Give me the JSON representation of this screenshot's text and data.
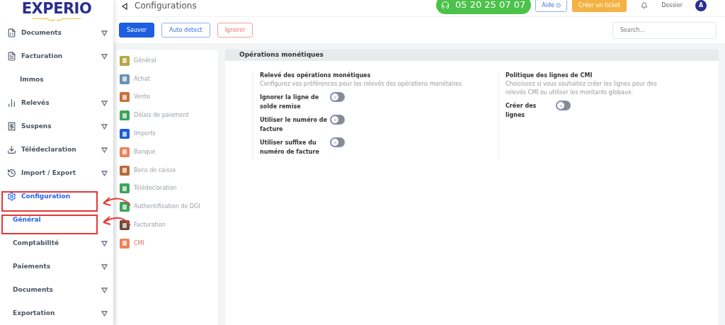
{
  "logo": {
    "text": "EXPERIO"
  },
  "sidebar": {
    "items": [
      {
        "label": "Documents",
        "kind": "group",
        "expandable": true,
        "selected": false
      },
      {
        "label": "Facturation",
        "kind": "group",
        "expandable": true,
        "selected": false
      },
      {
        "label": "Immos",
        "kind": "sub",
        "expandable": false,
        "selected": false
      },
      {
        "label": "Relevés",
        "kind": "group",
        "expandable": true,
        "selected": false
      },
      {
        "label": "Suspens",
        "kind": "group",
        "expandable": true,
        "selected": false
      },
      {
        "label": "Télédeclaration",
        "kind": "group",
        "expandable": true,
        "selected": false
      },
      {
        "label": "Import / Export",
        "kind": "group",
        "expandable": true,
        "selected": false
      },
      {
        "label": "Configuration",
        "kind": "group",
        "expandable": false,
        "selected": true
      },
      {
        "label": "Général",
        "kind": "sub",
        "expandable": false,
        "selected": true
      },
      {
        "label": "Comptabilité",
        "kind": "sub",
        "expandable": true,
        "selected": false
      },
      {
        "label": "Paiements",
        "kind": "sub",
        "expandable": true,
        "selected": false
      },
      {
        "label": "Documents",
        "kind": "sub",
        "expandable": true,
        "selected": false
      },
      {
        "label": "Exportation",
        "kind": "sub",
        "expandable": true,
        "selected": false
      }
    ]
  },
  "header": {
    "title": "Configurations",
    "phone": "05 20 25 07 07",
    "help": "Aide",
    "ticket": "Créer un ticket",
    "folder": "Dossier",
    "avatar": "A"
  },
  "toolbar": {
    "buttons": [
      {
        "label": "Sauver",
        "kind": "primary"
      },
      {
        "label": "Auto detect",
        "kind": "outline"
      },
      {
        "label": "Ignorer",
        "kind": "danger"
      }
    ],
    "search": {
      "placeholder": "Search..."
    }
  },
  "config_menu": [
    {
      "label": "Général",
      "color": "#b5a642",
      "selected": false
    },
    {
      "label": "Achat",
      "color": "#6d8fb3",
      "selected": false
    },
    {
      "label": "Vente",
      "color": "#c8703a",
      "selected": false
    },
    {
      "label": "Délais de paiement",
      "color": "#3aa35c",
      "selected": false
    },
    {
      "label": "Imports",
      "color": "#1e5bd6",
      "selected": false
    },
    {
      "label": "Banque",
      "color": "#e8845a",
      "selected": false
    },
    {
      "label": "Bons de caisse",
      "color": "#b86a3c",
      "selected": false
    },
    {
      "label": "Télédeclaration",
      "color": "#3aa35c",
      "selected": false
    },
    {
      "label": "Authentification de DGI",
      "color": "#3aa35c",
      "selected": false
    },
    {
      "label": "Facturation",
      "color": "#6b4a3a",
      "selected": false
    },
    {
      "label": "CMI",
      "color": "#e8845a",
      "selected": true
    }
  ],
  "panel": {
    "title": "Opérations monétiques",
    "sections": [
      {
        "title": "Relevé des opérations monétiques",
        "description": "Configurez vos préférences pour les relevés des opérations monétaires",
        "settings": [
          {
            "label": "Ignorer la ligne de solde remise",
            "on": false
          },
          {
            "label": "Utiliser le numéro de facture",
            "on": false
          },
          {
            "label": "Utiliser suffixe du numéro de facture",
            "on": false
          }
        ]
      },
      {
        "title": "Politique des lignes de CMI",
        "description": "Choisissez si vous souhaitez créer les lignes pour des relevés CMI ou utiliser les montants globaux.",
        "settings": [
          {
            "label": "Créer des lignes",
            "on": false
          }
        ]
      }
    ]
  }
}
